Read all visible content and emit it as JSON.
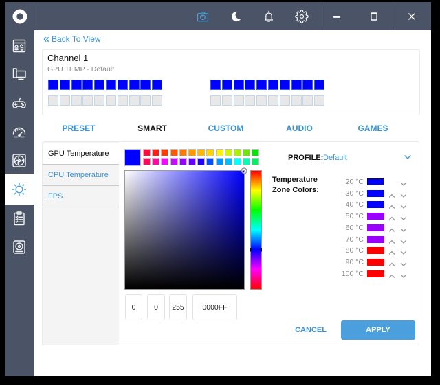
{
  "titlebar": {
    "actions": [
      {
        "icon": "camera-icon",
        "active": true
      },
      {
        "icon": "moon-icon",
        "active": false
      },
      {
        "icon": "bell-icon",
        "active": false
      },
      {
        "icon": "gear-icon",
        "active": false
      }
    ],
    "window_controls": [
      {
        "icon": "minimize-icon"
      },
      {
        "icon": "maximize-icon"
      },
      {
        "icon": "close-icon"
      }
    ]
  },
  "sidebar": {
    "logo": "logo-icon",
    "items": [
      {
        "icon": "dashboard-icon",
        "active": false
      },
      {
        "icon": "pc-icon",
        "active": false
      },
      {
        "icon": "gamepad-icon",
        "active": false
      },
      {
        "icon": "speedometer-icon",
        "active": false
      },
      {
        "icon": "fan-icon",
        "active": false
      },
      {
        "icon": "lighting-icon",
        "active": true
      },
      {
        "icon": "clipboard-icon",
        "active": false
      },
      {
        "icon": "speaker-icon",
        "active": false
      }
    ]
  },
  "back_link": {
    "label": "Back To View",
    "icon": "double-chevron-left-icon"
  },
  "channel": {
    "title": "Channel 1",
    "subtitle": "GPU TEMP - Default",
    "led_groups": [
      {
        "top": [
          "#0000FF",
          "#0000FF",
          "#0000FF",
          "#0000FF",
          "#0000FF",
          "#0000FF",
          "#0000FF",
          "#0000FF",
          "#0000FF",
          "#0000FF"
        ],
        "bottom": [
          "#E8E8E8",
          "#E8E8E8",
          "#E8E8E8",
          "#E8E8E8",
          "#E8E8E8",
          "#E8E8E8",
          "#E8E8E8",
          "#E8E8E8",
          "#E8E8E8",
          "#E8E8E8"
        ]
      },
      {
        "top": [
          "#0000FF",
          "#0000FF",
          "#0000FF",
          "#0000FF",
          "#0000FF",
          "#0000FF",
          "#0000FF",
          "#0000FF",
          "#0000FF",
          "#0000FF"
        ],
        "bottom": [
          "#E8E8E8",
          "#E8E8E8",
          "#E8E8E8",
          "#E8E8E8",
          "#E8E8E8",
          "#E8E8E8",
          "#E8E8E8",
          "#E8E8E8",
          "#E8E8E8",
          "#E8E8E8"
        ]
      }
    ]
  },
  "tabs": [
    {
      "label": "PRESET",
      "active": false
    },
    {
      "label": "SMART",
      "active": true
    },
    {
      "label": "CUSTOM",
      "active": false
    },
    {
      "label": "AUDIO",
      "active": false
    },
    {
      "label": "GAMES",
      "active": false
    }
  ],
  "sources": [
    {
      "label": "GPU Temperature",
      "active": true
    },
    {
      "label": "CPU Temperature",
      "active": false
    },
    {
      "label": "FPS",
      "active": false
    }
  ],
  "color_picker": {
    "current_color": "#0000FF",
    "hue_degrees": 240,
    "saturation": 1,
    "value": 1,
    "r": "0",
    "g": "0",
    "b": "255",
    "hex": "0000FF",
    "palette": [
      [
        "#FF0A3C",
        "#FF1E14",
        "#FF3C00",
        "#FF5A00",
        "#FF7800",
        "#FF9B00",
        "#FFB900",
        "#FFD700",
        "#FFF500",
        "#D2F500",
        "#AAF000",
        "#6EE600",
        "#00E600"
      ],
      [
        "#FF0A5A",
        "#FF0AA0",
        "#F00AFF",
        "#C80AFF",
        "#9600FF",
        "#6400FF",
        "#1E00FF",
        "#0050FF",
        "#0096FF",
        "#00BEFF",
        "#00FFFF",
        "#00FFB4",
        "#00F064"
      ]
    ]
  },
  "profile": {
    "label": "PROFILE:",
    "value": "Default",
    "icon": "chevron-down-icon"
  },
  "zones": {
    "label_line1": "Temperature",
    "label_line2": "Zone Colors:",
    "items": [
      {
        "temp": "20 °C",
        "color": "#0000FF",
        "selected": true,
        "up": false,
        "down": true
      },
      {
        "temp": "30 °C",
        "color": "#0000FF",
        "selected": false,
        "up": true,
        "down": true
      },
      {
        "temp": "40 °C",
        "color": "#0000FF",
        "selected": false,
        "up": true,
        "down": true
      },
      {
        "temp": "50 °C",
        "color": "#9900FF",
        "selected": false,
        "up": true,
        "down": true
      },
      {
        "temp": "60 °C",
        "color": "#9900FF",
        "selected": false,
        "up": true,
        "down": true
      },
      {
        "temp": "70 °C",
        "color": "#9900FF",
        "selected": false,
        "up": true,
        "down": true
      },
      {
        "temp": "80 °C",
        "color": "#FF0000",
        "selected": false,
        "up": true,
        "down": true
      },
      {
        "temp": "90 °C",
        "color": "#FF0000",
        "selected": false,
        "up": true,
        "down": true
      },
      {
        "temp": "100 °C",
        "color": "#FF0000",
        "selected": false,
        "up": true,
        "down": true
      }
    ]
  },
  "actions": {
    "cancel": "CANCEL",
    "apply": "APPLY"
  },
  "colors": {
    "accent": "#4C9FDD",
    "link": "#3B93D6",
    "chrome": "#4B5466"
  }
}
